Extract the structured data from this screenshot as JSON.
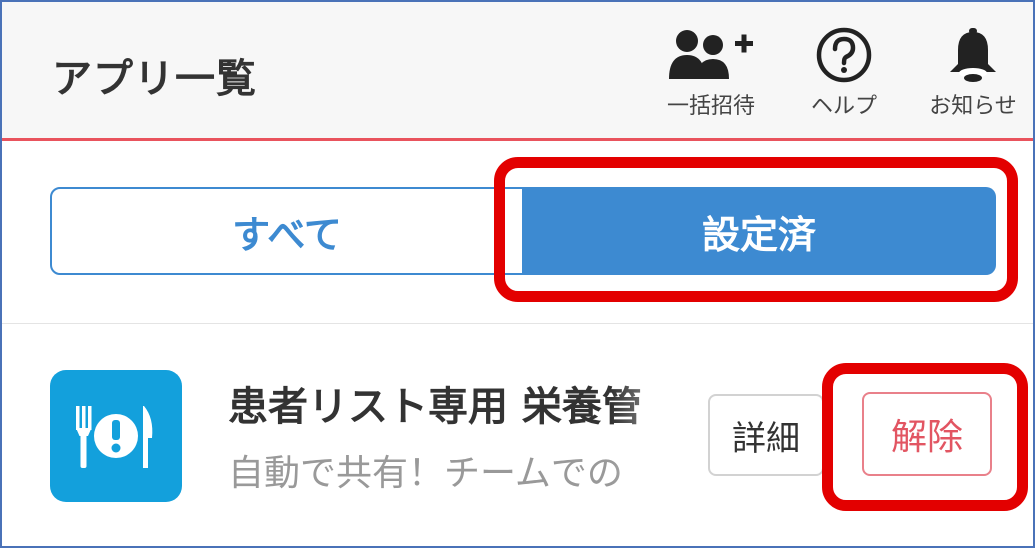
{
  "header": {
    "title": "アプリ一覧",
    "accent_color": "#e9535d",
    "actions": [
      {
        "label": "一括招待",
        "icon": "add-users-icon"
      },
      {
        "label": "ヘルプ",
        "icon": "help-icon"
      },
      {
        "label": "お知らせ",
        "icon": "bell-icon"
      }
    ]
  },
  "tabs": {
    "all_label": "すべて",
    "configured_label": "設定済",
    "selected": "設定済",
    "color": "#3d8ad1"
  },
  "app": {
    "name": "患者リスト専用 栄養管",
    "description": "自動で共有！チームでの",
    "icon": "meal-alert-icon",
    "icon_color": "#13a0dc",
    "detail_label": "詳細",
    "release_label": "解除"
  },
  "annotation": {
    "color": "#e30000"
  }
}
